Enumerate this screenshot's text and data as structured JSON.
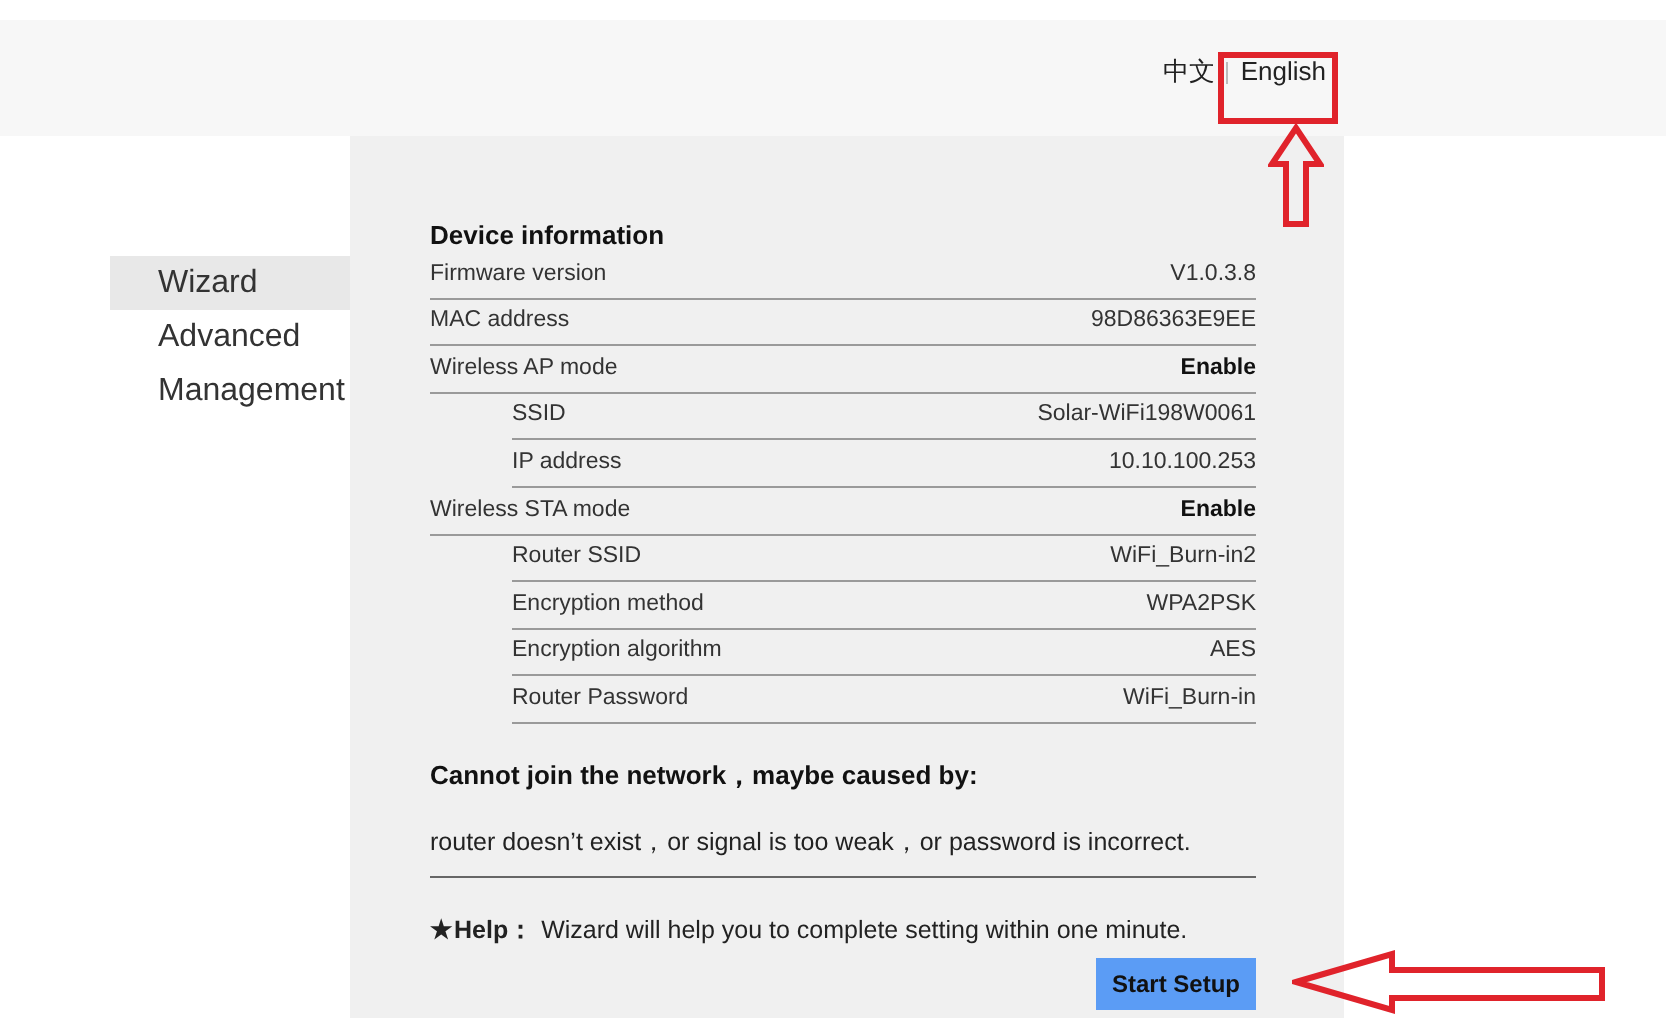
{
  "languages": [
    "中文",
    "English"
  ],
  "sidebar": {
    "items": [
      {
        "label": "Wizard",
        "selected": true
      },
      {
        "label": "Advanced",
        "selected": false
      },
      {
        "label": "Management",
        "selected": false
      }
    ]
  },
  "device_information": {
    "title": "Device information",
    "rows": [
      {
        "label": "Firmware version",
        "value": "V1.0.3.8"
      },
      {
        "label": "MAC address",
        "value": "98D86363E9EE"
      },
      {
        "label": "Wireless AP mode",
        "value": "Enable",
        "children": [
          {
            "label": "SSID",
            "value": "Solar-WiFi198W0061"
          },
          {
            "label": "IP address",
            "value": "10.10.100.253"
          }
        ]
      },
      {
        "label": "Wireless STA mode",
        "value": "Enable",
        "children": [
          {
            "label": "Router SSID",
            "value": "WiFi_Burn-in2"
          },
          {
            "label": "Encryption method",
            "value": "WPA2PSK"
          },
          {
            "label": "Encryption algorithm",
            "value": "AES"
          },
          {
            "label": "Router Password",
            "value": "WiFi_Burn-in"
          }
        ]
      }
    ]
  },
  "network_notice": {
    "title": "Cannot join the network，maybe caused by:",
    "message": "router doesn’t exist，or signal is too weak，or password is incorrect."
  },
  "help": {
    "text": "**★Help：** Wizard will help you to complete setting within one minute.",
    "button": "Start Setup"
  }
}
